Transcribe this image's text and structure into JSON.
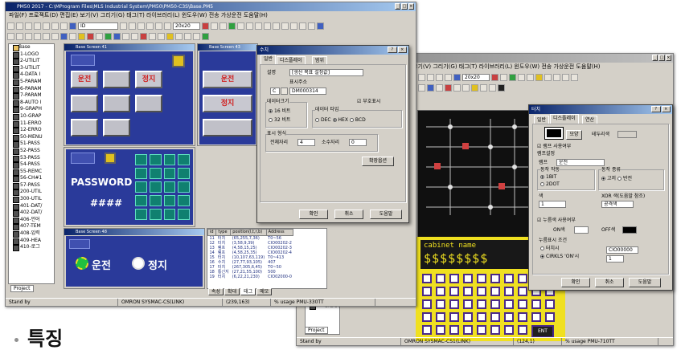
{
  "main_window": {
    "title": "PM50 2017 - C:\\MProgram Files\\MLS Industrial System\\PM50\\PM50-C3S\\Base.PM5",
    "menu": "파일(F)  프로젝트(D)  편집(E)  보기(V)  그리기(G)  태그(T)  라이브러리(L)  윈도우(W)  전송  가상운전  도움말(H)",
    "combo_id": "ID",
    "combo_grid": "20x20",
    "tree_items": [
      "Base",
      "1-LOGO",
      "2-UTILIT",
      "3-UTILIT",
      "4-DATA I",
      "5-PARAM",
      "6-PARAM",
      "7-PARAM",
      "8-AUTO I",
      "9-GRAPH",
      "10-GRAP",
      "11-ERRO",
      "12-ERRO",
      "50-MENU",
      "51-PASS",
      "52-PASS",
      "53-PASS",
      "54-PASS",
      "55-REMC",
      "56-CH#1",
      "57-PASS",
      "200-UTIL",
      "300-UTIL",
      "401-DAT/",
      "402-DAT/",
      "406-언어",
      "407-TEM",
      "408-입력",
      "409-HEA",
      "410-로그"
    ],
    "tree_tab": "Project",
    "status": {
      "ready": "Stand by",
      "plc": "OMRON SYSMAC-CS(LINK)",
      "pos": "(239,163)",
      "usage": "% usage  PMU-330TT"
    },
    "screens": {
      "s1_label": "Base Screen 41",
      "s2_label": "Base Screen 43",
      "s3_label": "Base Screen 48"
    },
    "bt_run": "운전",
    "bt_stop": "정지",
    "bt_run2": "운전",
    "bt_stop2": "정지",
    "password_label": "PASSWORD",
    "password_value": "####",
    "tag_head": "입력",
    "tag_head2": "STOP",
    "run_on": "운전",
    "run_off": "정지"
  },
  "list": {
    "headers": [
      "id",
      "type",
      "position(l,t,r,b)",
      "Address"
    ],
    "rows": [
      [
        "11",
        "터치",
        "(65,255,7,36)",
        "T0~56"
      ],
      [
        "12",
        "터치",
        "(3,58,9,39)",
        "CIO00202-2"
      ],
      [
        "13",
        "램프",
        "(4,58,15,25)",
        "CIO00202-3"
      ],
      [
        "14",
        "램프",
        "(4,58,25,35)",
        "CIO00202-4"
      ],
      [
        "15",
        "터치",
        "(10,107,63,119)",
        "T0~413"
      ],
      [
        "16",
        "수치",
        "(27,77,93,105)",
        "407"
      ],
      [
        "17",
        "터치",
        "(267,305,6,45)",
        "T0~50"
      ],
      [
        "18",
        "통신지",
        "(27,21,55,100)",
        "500"
      ],
      [
        "19",
        "터치",
        "(6,22,21,230)",
        "CIO02000-0"
      ]
    ],
    "tabs": [
      "속성",
      "확대",
      "태그",
      "메모"
    ]
  },
  "dialog1": {
    "title": "수치",
    "tabs": [
      "일반",
      "디스플레이",
      "범위"
    ],
    "desc_label": "설명",
    "desc_value": "[생산 목표 설정값]",
    "addr_label": "표시주소",
    "addr_prefix": "C",
    "addr_value": "DM000314",
    "size_group": "데이터크기",
    "size_16": "16 비트",
    "size_32": "32 비트",
    "type_group": "데이터 타입",
    "type_dec": "DEC",
    "type_hex": "HEX",
    "type_bcd": "BCD",
    "sign_check": "부호표시",
    "format_group": "표시 형식",
    "total_digits": "전체자리",
    "total_value": "4",
    "decimal_label": "소수자리",
    "decimal_value": "0",
    "ext_button": "확장옵션",
    "ok": "확인",
    "cancel": "취소",
    "help": "도움말"
  },
  "right_window": {
    "menu": "보기(V)  그리기(G)  태그(T)  라이브러리(L)  윈도우(W)  전송  가상운전  도움말(H)",
    "combo_grid": "20x20",
    "lcd_title": "cabinet name",
    "lcd_value": "$$$$$$$$",
    "key_enter": "ENT",
    "status": {
      "ready": "Stand by",
      "plc": "OMRON SYSMAC-CS1(LINK)",
      "pos": "(124,1)",
      "usage": "% usage  PMU-710TT"
    },
    "tree_items": [
      "11-partview",
      "12-값설정을"
    ],
    "tree_tab": "Project"
  },
  "dialog2": {
    "title": "터치",
    "tabs": [
      "일반",
      "디스플레이",
      "연산"
    ],
    "shape_button": "모양",
    "frame_color_label": "테두리색",
    "use_lamp": "램프 사용여부",
    "lamp_setting": "램프설정",
    "lamp_addr_label": "램프",
    "lamp_addr_value": "운전",
    "oper_group": "동작 작동",
    "oper_1": "1BIT",
    "oper_2": "2DOT",
    "ctrl_group": "동작 종류",
    "ctrl_1": "고저",
    "ctrl_2": "반전",
    "color_label": "색",
    "color_value": "1",
    "xor_label": "XOR 색(도움말 참조)",
    "xor_value": "공격색",
    "use_disp": "누름색 사용여부",
    "on_label": "ON색",
    "off_label": "OFF색",
    "cond_group": "누름표시 조건",
    "cond_1": "터치시",
    "cond_2": "CIRKLS 'ON'시",
    "cond_addr": "CIO00000",
    "cond_bit": "1",
    "ok": "확인",
    "cancel": "취소",
    "help": "도움말"
  },
  "caption": "특징"
}
